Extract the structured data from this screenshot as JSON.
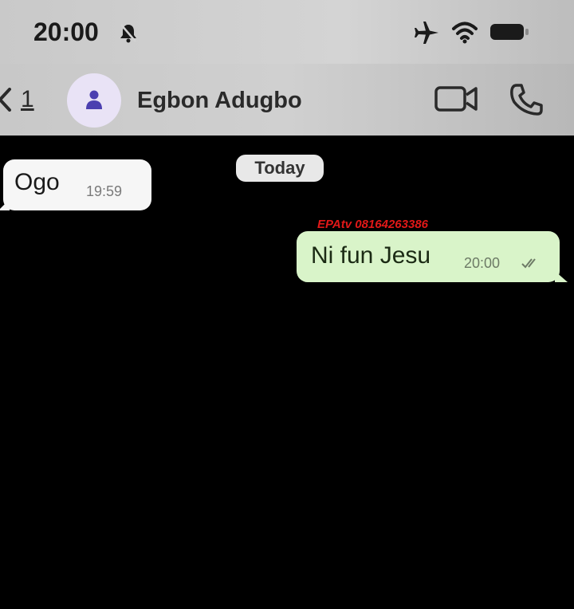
{
  "status_bar": {
    "time": "20:00",
    "icons": [
      "bell-muted-icon",
      "airplane-icon",
      "wifi-icon",
      "battery-icon"
    ]
  },
  "header": {
    "back_count": "1",
    "contact_name": "Egbon Adugbo",
    "icons": [
      "back-chevron-icon",
      "avatar-person-icon",
      "video-call-icon",
      "phone-icon"
    ]
  },
  "chat": {
    "date_label": "Today",
    "messages": [
      {
        "direction": "incoming",
        "text": "Ogo",
        "time": "19:59"
      },
      {
        "direction": "outgoing",
        "text": "Ni fun Jesu",
        "time": "20:00",
        "status": "read-ticks-icon"
      }
    ],
    "watermark": "EPAtv 08164263386"
  },
  "colors": {
    "background": "#000000",
    "header_bg": "#cccccc",
    "incoming_bubble": "#f6f6f6",
    "outgoing_bubble": "#d9f4c9",
    "watermark": "#e01818",
    "avatar_bg": "#e9e3f6",
    "avatar_icon": "#4b3fb0"
  }
}
